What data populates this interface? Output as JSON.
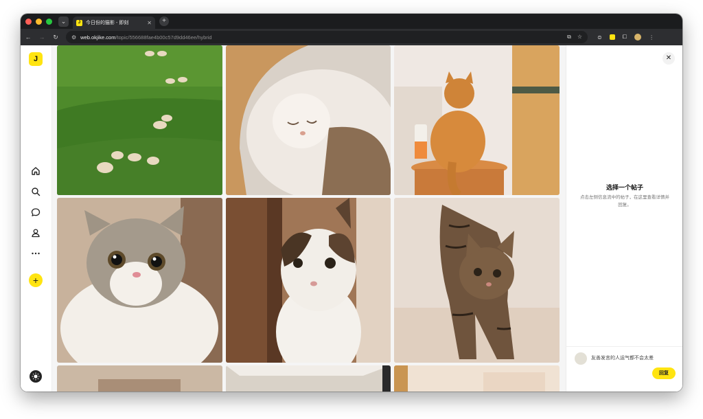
{
  "browser": {
    "tab_title": "今日份的猫影 - 即刻",
    "tab_favicon": "J",
    "url_host": "web.okjike.com",
    "url_path": "/topic/556688fae4b00c57d9dd46ee/hybrid"
  },
  "sidebar": {
    "logo": "J",
    "items": [
      {
        "icon": "home-icon"
      },
      {
        "icon": "search-icon"
      },
      {
        "icon": "message-icon"
      },
      {
        "icon": "profile-icon"
      },
      {
        "icon": "more-icon"
      }
    ],
    "add_label": "+"
  },
  "grid": {
    "tiles": [
      {
        "subject": "sheep grazing on green hillside"
      },
      {
        "subject": "sleeping white cat in wooden bed"
      },
      {
        "subject": "orange cat sitting on round table"
      },
      {
        "subject": "scottish fold tabby kitten"
      },
      {
        "subject": "white and brown cat peeking from door"
      },
      {
        "subject": "tabby cat walking"
      },
      {
        "subject": "partial photo"
      },
      {
        "subject": "partial photo"
      },
      {
        "subject": "partial photo"
      }
    ]
  },
  "panel": {
    "close_label": "✕",
    "empty_title": "选择一个帖子",
    "empty_desc": "点击左侧信息流中的帖子，在这里查看详情并回复。",
    "reply_placeholder": "友善发言的人运气都不会太差",
    "reply_button": "回复"
  },
  "colors": {
    "brand_yellow": "#ffe411",
    "browser_dark": "#1b1c1e"
  }
}
